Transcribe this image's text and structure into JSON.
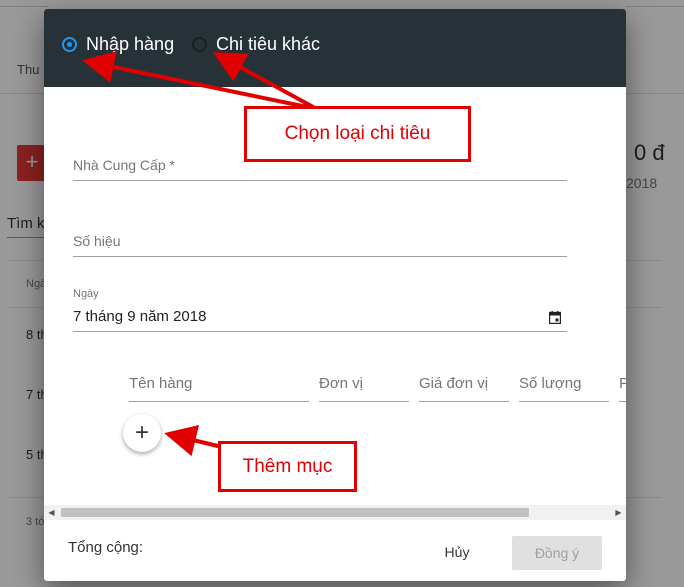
{
  "background": {
    "tab_label": "Thu",
    "add_button_label": "+",
    "search_label": "Tìm k",
    "column_head": "Ngà",
    "rows": [
      "8 th",
      "7 th",
      "5 th"
    ],
    "footer_text": "3 tớ",
    "total_partial": "0 đ",
    "year_partial": "2018"
  },
  "dialog": {
    "radio_options": [
      {
        "label": "Nhập hàng",
        "selected": true
      },
      {
        "label": "Chi tiêu khác",
        "selected": false
      }
    ],
    "supplier_label": "Nhà Cung Cấp *",
    "number_label": "Số hiệu",
    "date_label": "Ngày",
    "date_value": "7 tháng 9 năm 2018",
    "item_columns": [
      "Tên hàng",
      "Đơn vị",
      "Giá đơn vị",
      "Số lượng",
      "F"
    ],
    "add_item_symbol": "+",
    "total_label": "Tổng cộng:",
    "cancel_label": "Hủy",
    "confirm_label": "Đồng ý"
  },
  "annotations": {
    "callout_type": "Chọn loại chi tiêu",
    "callout_add": "Thêm mục"
  },
  "colors": {
    "header_bg": "#263238",
    "radio_accent": "#2196f3",
    "annotation_red": "#e00000"
  }
}
